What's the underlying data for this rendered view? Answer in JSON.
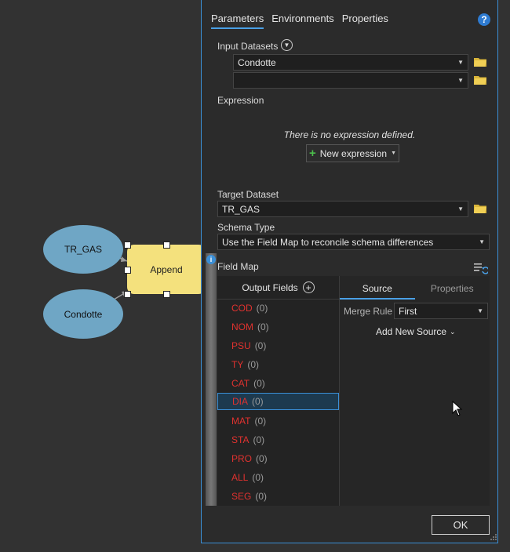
{
  "canvas": {
    "nodes": [
      {
        "label": "TR_GAS"
      },
      {
        "label": "Condotte"
      }
    ],
    "tool": {
      "label": "Append"
    }
  },
  "dialog": {
    "tabs": [
      "Parameters",
      "Environments",
      "Properties"
    ],
    "help_glyph": "?",
    "input_datasets": {
      "label": "Input Datasets",
      "values": [
        "Condotte",
        ""
      ]
    },
    "expression": {
      "label": "Expression",
      "empty_text": "There is no expression defined.",
      "new_button": "New expression"
    },
    "target_dataset": {
      "label": "Target Dataset",
      "value": "TR_GAS"
    },
    "schema_type": {
      "label": "Schema Type",
      "value": "Use the Field Map to reconcile schema differences"
    },
    "field_map": {
      "label": "Field Map",
      "output_fields_header": "Output Fields",
      "fields": [
        {
          "name": "COD",
          "count": "(0)"
        },
        {
          "name": "NOM",
          "count": "(0)"
        },
        {
          "name": "PSU",
          "count": "(0)"
        },
        {
          "name": "TY",
          "count": "(0)"
        },
        {
          "name": "CAT",
          "count": "(0)"
        },
        {
          "name": "DIA",
          "count": "(0)"
        },
        {
          "name": "MAT",
          "count": "(0)"
        },
        {
          "name": "STA",
          "count": "(0)"
        },
        {
          "name": "PRO",
          "count": "(0)"
        },
        {
          "name": "ALL",
          "count": "(0)"
        },
        {
          "name": "SEG",
          "count": "(0)"
        }
      ],
      "selected_field": "DIA",
      "source_tabs": [
        "Source",
        "Properties"
      ],
      "merge_rule_label": "Merge Rule",
      "merge_rule_value": "First",
      "add_source": "Add New Source"
    },
    "ok_button": "OK",
    "colors": {
      "accent": "#3b8fd6",
      "field_name": "#e0322f",
      "tool": "#f4e17d",
      "node": "#6fa6c5"
    }
  }
}
